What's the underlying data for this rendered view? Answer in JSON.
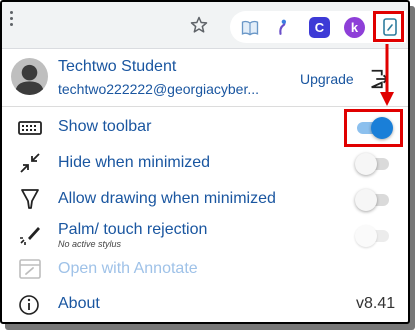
{
  "browser": {
    "icons": [
      "more-menu-icon",
      "bookmark-star-icon",
      "extension-book-icon",
      "extension-pin-icon",
      "extension-c-icon",
      "extension-k-icon",
      "annotate-extension-icon"
    ],
    "ext3_letter": "C",
    "ext4_letter": "k"
  },
  "user": {
    "name": "Techtwo Student",
    "email": "techtwo222222@georgiacyber...",
    "upgrade_label": "Upgrade"
  },
  "settings": {
    "items": [
      {
        "label": "Show toolbar",
        "icon": "keyboard-icon",
        "toggle_on": true,
        "enabled": true
      },
      {
        "label": "Hide when minimized",
        "icon": "minimize-arrows-icon",
        "toggle_on": false,
        "enabled": true
      },
      {
        "label": "Allow drawing when minimized",
        "icon": "funnel-icon",
        "toggle_on": false,
        "enabled": true
      },
      {
        "label": "Palm/ touch rejection",
        "note": "No active stylus",
        "icon": "pen-sparkle-icon",
        "toggle_on": false,
        "enabled": false
      },
      {
        "label": "Open with Annotate",
        "icon": "annotate-window-icon",
        "enabled": false
      }
    ]
  },
  "about": {
    "label": "About",
    "version": "v8.41"
  },
  "colors": {
    "accent": "#1a7fd8",
    "link": "#1a56a0",
    "highlight": "#e00000"
  }
}
